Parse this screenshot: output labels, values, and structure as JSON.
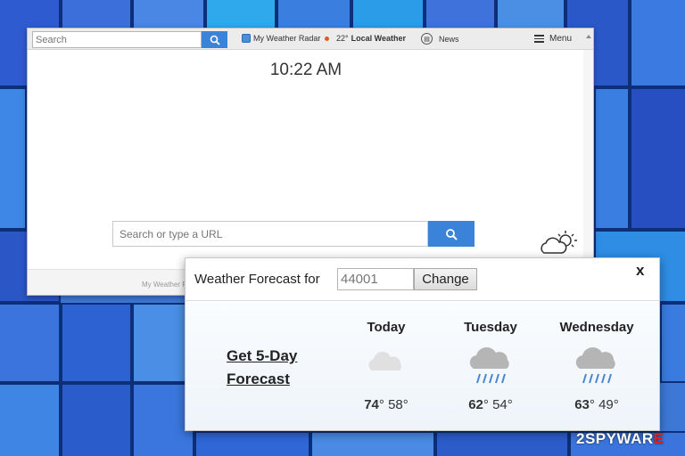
{
  "toolbar": {
    "search_placeholder": "Search",
    "links": [
      {
        "label": "My Weather Radar",
        "icon": "radar-icon"
      },
      {
        "label": "Local Weather",
        "temperature": "22°",
        "icon": "location-dot-icon"
      },
      {
        "label": "News",
        "icon": "news-icon"
      }
    ],
    "menu_label": "Menu"
  },
  "main": {
    "time": "10:22 AM",
    "search_placeholder": "Search or type a URL"
  },
  "footer": {
    "text": "My Weather R"
  },
  "popup": {
    "label": "Weather Forecast for",
    "zip_value": "44001",
    "change_label": "Change",
    "close_label": "x",
    "five_day_line1": "Get 5-Day",
    "five_day_line2": "Forecast",
    "days": [
      {
        "name": "Today",
        "high": "74",
        "low": "58°",
        "icon": "cloudy-icon"
      },
      {
        "name": "Tuesday",
        "high": "62",
        "low": "54°",
        "icon": "rain-cloud-icon"
      },
      {
        "name": "Wednesday",
        "high": "63",
        "low": "49°",
        "icon": "rain-cloud-icon"
      }
    ]
  },
  "watermark": {
    "prefix": "2",
    "main": "SPYWAR",
    "red": "E"
  },
  "colors": {
    "accent": "#3a83d9",
    "background": "#3d78d6"
  }
}
